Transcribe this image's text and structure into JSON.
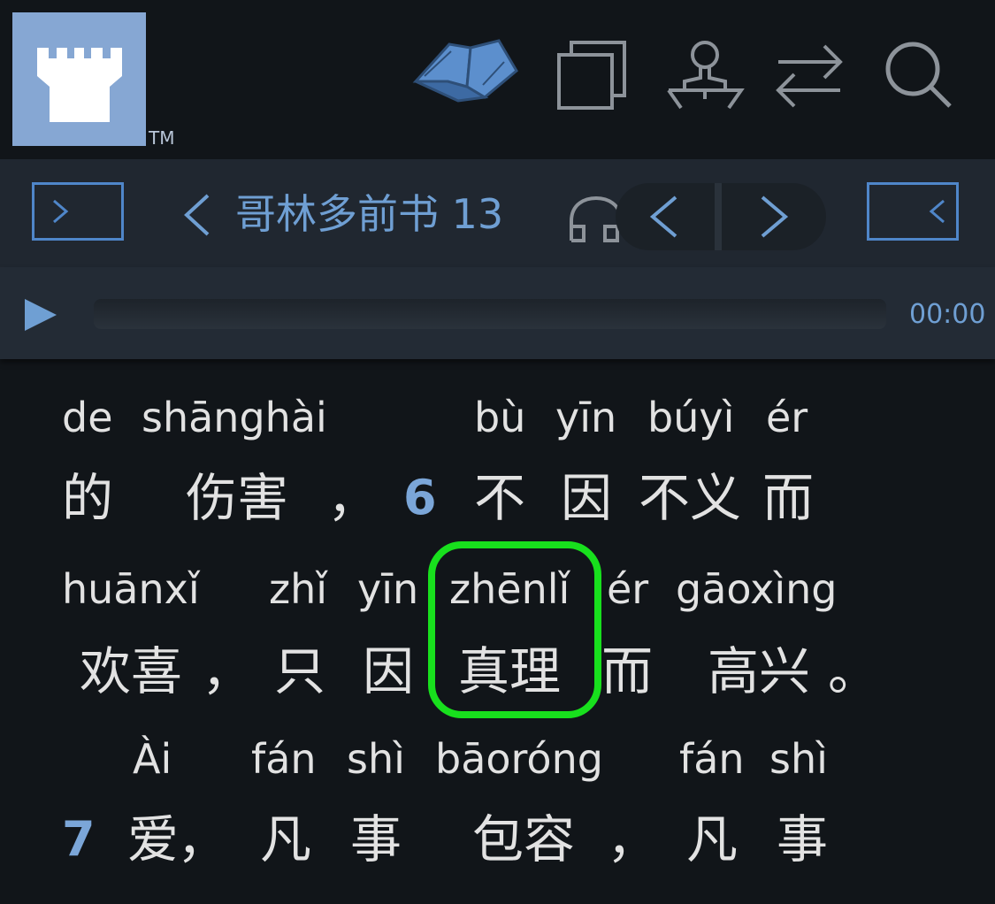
{
  "header": {
    "trademark": "TM",
    "icons": [
      "book-icon",
      "copy-icon",
      "speaker-icon",
      "swap-icon",
      "search-icon"
    ]
  },
  "nav": {
    "chapter_title": "哥林多前书 13"
  },
  "audio": {
    "time": "00:00",
    "progress": 0
  },
  "reader": {
    "lines": [
      {
        "pinyin": [
          "de",
          "shānghài",
          "bù",
          "yīn",
          "búyì",
          "ér"
        ],
        "hanzi": [
          "的",
          "伤害",
          "，",
          "不",
          "因",
          "不义",
          "而"
        ],
        "verse": "6"
      },
      {
        "pinyin": [
          "huānxǐ",
          "zhǐ",
          "yīn",
          "zhēnlǐ",
          "ér",
          "gāoxìng"
        ],
        "hanzi": [
          "欢喜",
          "，",
          "只",
          "因",
          "真理",
          "而",
          "高兴",
          "。"
        ]
      },
      {
        "pinyin": [
          "Ài",
          "fán",
          "shì",
          "bāoróng",
          "fán",
          "shì"
        ],
        "hanzi": [
          "爱",
          "，",
          "凡",
          "事",
          "包容",
          "，",
          "凡",
          "事"
        ],
        "verse": "7"
      }
    ]
  },
  "colors": {
    "accent": "#6f9fd3",
    "highlight": "#18e01d",
    "logo": "#86a7d3"
  }
}
